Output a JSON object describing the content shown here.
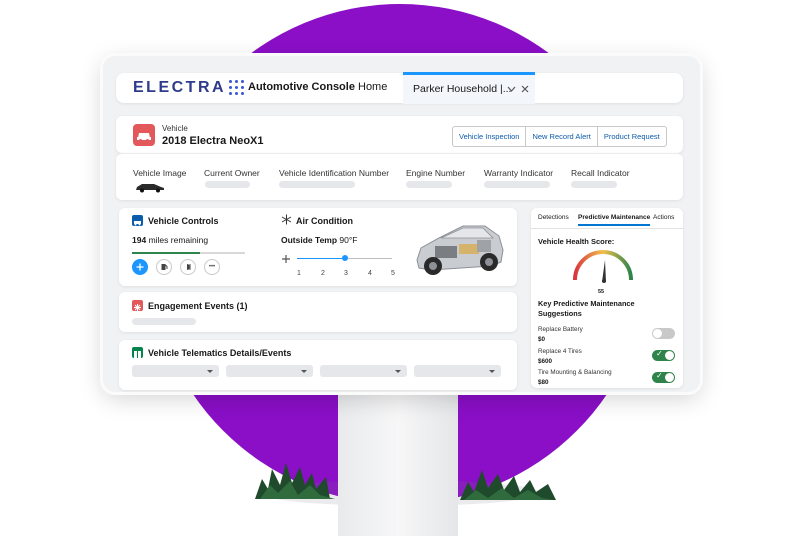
{
  "app": {
    "logo": "ELECTRA",
    "console_name": "Automotive Console",
    "nav_home": "Home",
    "active_tab": "Parker Household |...",
    "colors": {
      "brand_purple": "#8a0fc6",
      "accent_blue": "#1b96ff",
      "vehicle_icon_red": "#e3595b",
      "success_green": "#2e844a"
    }
  },
  "vehicle": {
    "label": "Vehicle",
    "title": "2018 Electra NeoX1",
    "actions": [
      "Vehicle Inspection",
      "New Record Alert",
      "Product Request"
    ],
    "fields": [
      "Vehicle Image",
      "Current Owner",
      "Vehicle Identification Number",
      "Engine Number",
      "Warranty Indicator",
      "Recall Indicator"
    ]
  },
  "controls": {
    "title": "Vehicle Controls",
    "miles_value": "194",
    "miles_label": "miles remaining",
    "miles_progress_fraction": 0.6,
    "buttons": [
      "fan-icon",
      "fuel-icon",
      "light-icon",
      "more-icon"
    ],
    "more_glyph": "•••"
  },
  "air": {
    "title": "Air Condition",
    "temp_label": "Outside Temp",
    "temp_value": "90°F",
    "slider_ticks": [
      "1",
      "2",
      "3",
      "4",
      "5"
    ],
    "slider_value": 3
  },
  "engagement": {
    "title": "Engagement Events (1)"
  },
  "telematics": {
    "title": "Vehicle Telematics Details/Events"
  },
  "side_panel": {
    "tabs": [
      "Detections",
      "Predictive Maintenance",
      "Actions"
    ],
    "active_tab_index": 1,
    "health_title": "Vehicle Health Score:",
    "health_score": "55",
    "suggestions_title_line1": "Key Predictive Maintenance",
    "suggestions_title_line2": "Suggestions",
    "suggestions": [
      {
        "name": "Replace Battery",
        "price": "$0",
        "enabled": false
      },
      {
        "name": "Replace 4 Tires",
        "price": "$600",
        "enabled": true
      },
      {
        "name": "Tire Mounting & Balancing",
        "price": "$80",
        "enabled": true
      }
    ],
    "check_glyph": "✓"
  }
}
